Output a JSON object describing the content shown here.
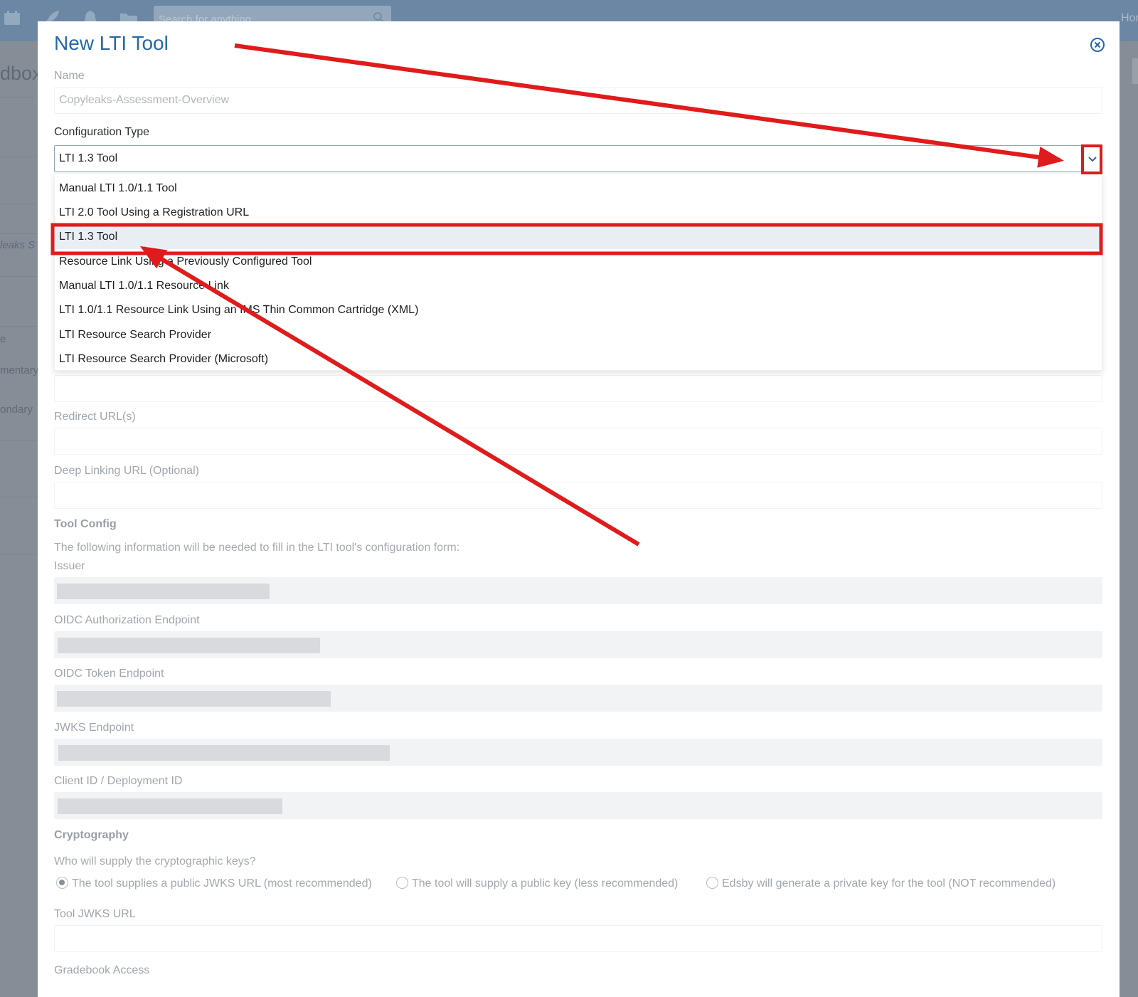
{
  "topbar": {
    "search_placeholder": "Search for anything",
    "home_label": "Hor",
    "icons": [
      "calendar-icon",
      "rocket-icon",
      "bell-icon",
      "folder-icon",
      "search-icon"
    ]
  },
  "background": {
    "side_texts": [
      "dbox",
      "leaks S",
      "e",
      "mentary",
      "ondary"
    ]
  },
  "modal": {
    "title": "New LTI Tool",
    "close_icon": "close-circle-icon",
    "name": {
      "label": "Name",
      "value": "Copyleaks-Assessment-Overview"
    },
    "config_type": {
      "label": "Configuration Type",
      "selected": "LTI 1.3 Tool",
      "options": [
        "Manual LTI 1.0/1.1 Tool",
        "LTI 2.0 Tool Using a Registration URL",
        "LTI 1.3 Tool",
        "Resource Link Using a Previously Configured Tool",
        "Manual LTI 1.0/1.1 Resource Link",
        "LTI 1.0/1.1 Resource Link Using an IMS Thin Common Cartridge (XML)",
        "LTI Resource Search Provider",
        "LTI Resource Search Provider (Microsoft)"
      ],
      "selected_index": 2
    },
    "redirect": {
      "label": "Redirect URL(s)"
    },
    "deep_linking": {
      "label": "Deep Linking URL (Optional)"
    },
    "tool_config": {
      "heading": "Tool Config",
      "help": "The following information will be needed to fill in the LTI tool's configuration form:",
      "fields": [
        {
          "label": "Issuer"
        },
        {
          "label": "OIDC Authorization Endpoint"
        },
        {
          "label": "OIDC Token Endpoint"
        },
        {
          "label": "JWKS Endpoint"
        },
        {
          "label": "Client ID / Deployment ID"
        }
      ]
    },
    "cryptography": {
      "heading": "Cryptography",
      "question": "Who will supply the cryptographic keys?",
      "options": [
        "The tool supplies a public JWKS URL (most recommended)",
        "The tool will supply a public key (less recommended)",
        "Edsby will generate a private key for the tool (NOT recommended)"
      ],
      "selected_index": 0
    },
    "tool_jwks": {
      "label": "Tool JWKS URL"
    },
    "gradebook": {
      "label": "Gradebook Access"
    }
  },
  "annotation_color": "#e01b1b"
}
